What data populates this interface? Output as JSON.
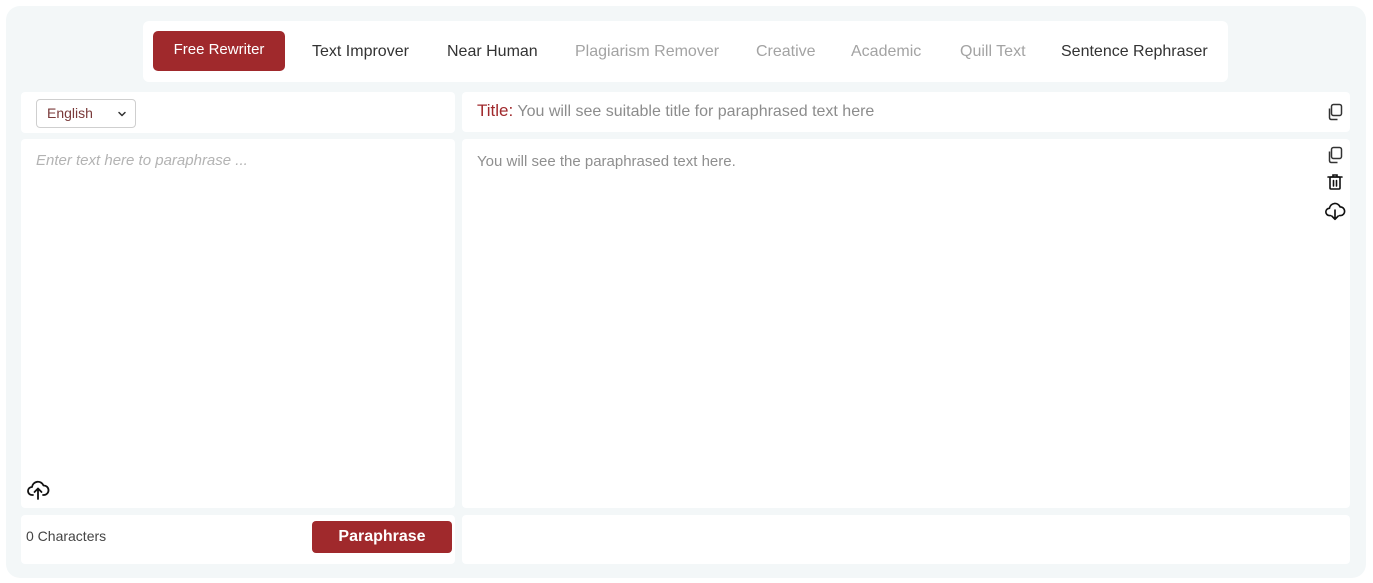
{
  "modes": [
    {
      "label": "Free Rewriter",
      "state": "active"
    },
    {
      "label": "Text Improver",
      "state": "enabled"
    },
    {
      "label": "Near Human",
      "state": "enabled"
    },
    {
      "label": "Plagiarism Remover",
      "state": "disabled"
    },
    {
      "label": "Creative",
      "state": "disabled"
    },
    {
      "label": "Academic",
      "state": "disabled"
    },
    {
      "label": "Quill Text",
      "state": "disabled"
    },
    {
      "label": "Sentence Rephraser",
      "state": "enabled"
    }
  ],
  "language": {
    "selected": "English"
  },
  "title": {
    "label": "Title:",
    "placeholder": "You will see suitable title for paraphrased text here"
  },
  "input": {
    "placeholder": "Enter text here to paraphrase ..."
  },
  "output": {
    "placeholder": "You will see the paraphrased text here."
  },
  "footer": {
    "char_count": "0 Characters",
    "paraphrase_label": "Paraphrase"
  },
  "icons": {
    "title_copy": "copy-icon",
    "output_copy": "copy-icon",
    "output_delete": "trash-icon",
    "output_download": "cloud-download-icon",
    "input_upload": "cloud-upload-icon",
    "language_chevron": "chevron-down-icon"
  },
  "colors": {
    "accent": "#a0292c",
    "background": "#f3f7f8"
  }
}
